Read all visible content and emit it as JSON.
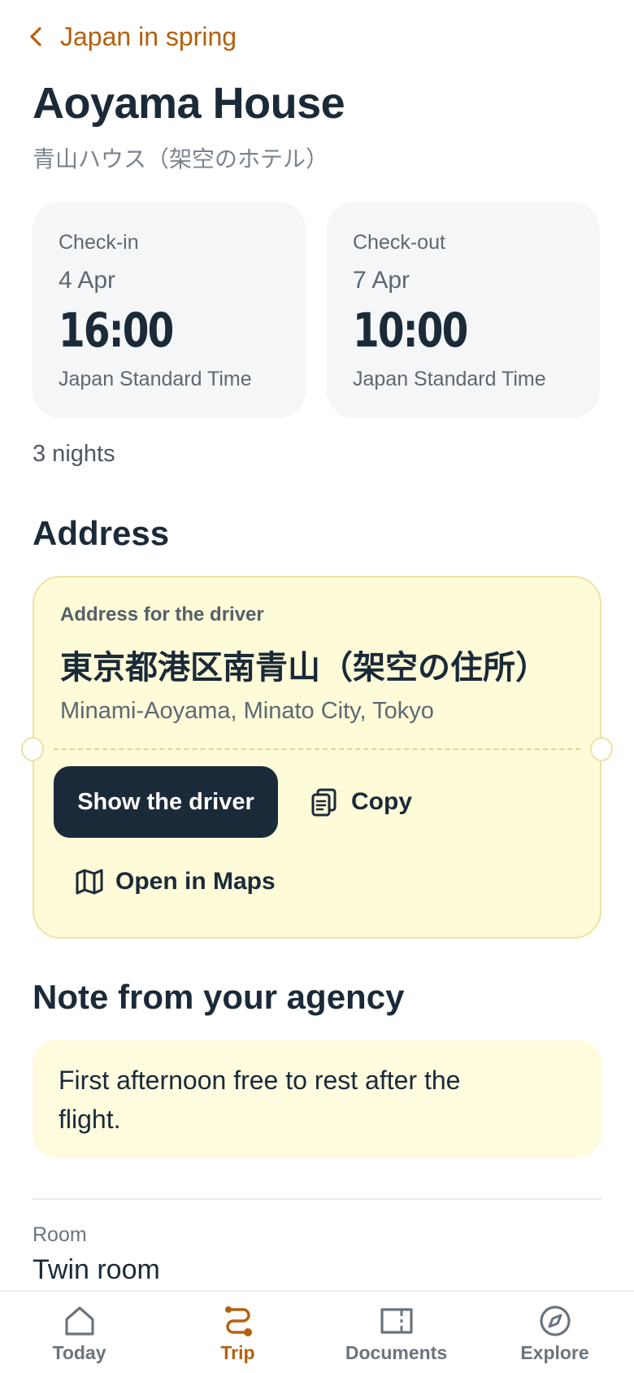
{
  "header": {
    "back_label": "Japan in spring",
    "title": "Aoyama House",
    "subtitle": "青山ハウス（架空のホテル）"
  },
  "checkin": {
    "label": "Check-in",
    "date": "4 Apr",
    "time": "16:00",
    "timezone": "Japan Standard Time"
  },
  "checkout": {
    "label": "Check-out",
    "date": "7 Apr",
    "time": "10:00",
    "timezone": "Japan Standard Time"
  },
  "nights": "3 nights",
  "address": {
    "heading": "Address",
    "kicker": "Address for the driver",
    "japanese": "東京都港区南青山（架空の住所）",
    "english": "Minami-Aoyama, Minato City, Tokyo",
    "show_driver_label": "Show the driver",
    "copy_label": "Copy",
    "maps_label": "Open in Maps"
  },
  "note": {
    "heading": "Note from your agency",
    "text": "First afternoon free to rest after the flight."
  },
  "room": {
    "label": "Room",
    "value": "Twin room"
  },
  "tabs": [
    {
      "label": "Today",
      "icon": "home-icon",
      "active": false
    },
    {
      "label": "Trip",
      "icon": "route-icon",
      "active": true
    },
    {
      "label": "Documents",
      "icon": "ticket-icon",
      "active": false
    },
    {
      "label": "Explore",
      "icon": "compass-icon",
      "active": false
    }
  ],
  "colors": {
    "accent": "#b5600c",
    "ink": "#1b2a38",
    "address_card_bg": "#fefbd9",
    "note_card_bg": "#fefbdf",
    "time_card_bg": "#f4f6f8"
  }
}
